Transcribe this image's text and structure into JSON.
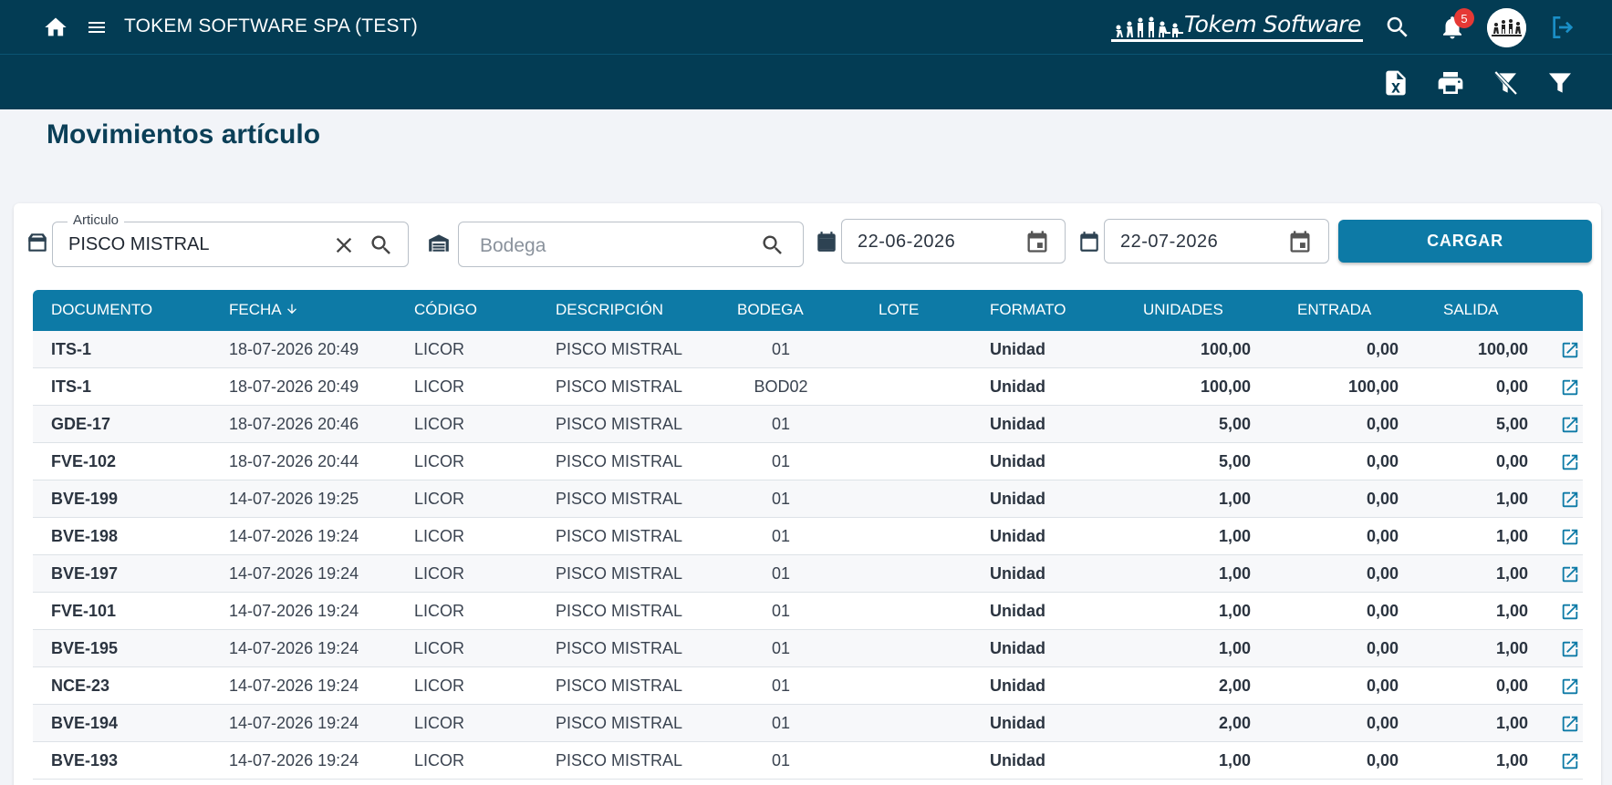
{
  "header": {
    "company": "TOKEM SOFTWARE SPA (TEST)",
    "brand": "Tokem Software",
    "notifications_count": "5",
    "icons": [
      "home-icon",
      "menu-icon",
      "search-icon",
      "bell-icon",
      "avatar",
      "logout-icon"
    ]
  },
  "toolbar": {
    "icons": [
      "excel-export-icon",
      "print-icon",
      "clear-filter-icon",
      "filter-icon"
    ]
  },
  "page": {
    "title": "Movimientos artículo"
  },
  "filters": {
    "articulo": {
      "label": "Articulo",
      "value": "PISCO MISTRAL"
    },
    "bodega": {
      "placeholder": "Bodega"
    },
    "fecha_desde": "22-06-2026",
    "fecha_hasta": "22-07-2026",
    "cargar_label": "CARGAR"
  },
  "table": {
    "columns": {
      "documento": "DOCUMENTO",
      "fecha": "FECHA",
      "codigo": "CÓDIGO",
      "descripcion": "DESCRIPCIÓN",
      "bodega": "BODEGA",
      "lote": "LOTE",
      "formato": "FORMATO",
      "unidades": "UNIDADES",
      "entrada": "ENTRADA",
      "salida": "SALIDA"
    },
    "sort": {
      "column": "fecha",
      "direction": "desc"
    },
    "rows": [
      {
        "documento": "ITS-1",
        "fecha": "18-07-2026 20:49",
        "codigo": "LICOR",
        "descripcion": "PISCO MISTRAL",
        "bodega": "01",
        "lote": "",
        "formato": "Unidad",
        "unidades": "100,00",
        "entrada": "0,00",
        "salida": "100,00"
      },
      {
        "documento": "ITS-1",
        "fecha": "18-07-2026 20:49",
        "codigo": "LICOR",
        "descripcion": "PISCO MISTRAL",
        "bodega": "BOD02",
        "lote": "",
        "formato": "Unidad",
        "unidades": "100,00",
        "entrada": "100,00",
        "salida": "0,00"
      },
      {
        "documento": "GDE-17",
        "fecha": "18-07-2026 20:46",
        "codigo": "LICOR",
        "descripcion": "PISCO MISTRAL",
        "bodega": "01",
        "lote": "",
        "formato": "Unidad",
        "unidades": "5,00",
        "entrada": "0,00",
        "salida": "5,00"
      },
      {
        "documento": "FVE-102",
        "fecha": "18-07-2026 20:44",
        "codigo": "LICOR",
        "descripcion": "PISCO MISTRAL",
        "bodega": "01",
        "lote": "",
        "formato": "Unidad",
        "unidades": "5,00",
        "entrada": "0,00",
        "salida": "0,00"
      },
      {
        "documento": "BVE-199",
        "fecha": "14-07-2026 19:25",
        "codigo": "LICOR",
        "descripcion": "PISCO MISTRAL",
        "bodega": "01",
        "lote": "",
        "formato": "Unidad",
        "unidades": "1,00",
        "entrada": "0,00",
        "salida": "1,00"
      },
      {
        "documento": "BVE-198",
        "fecha": "14-07-2026 19:24",
        "codigo": "LICOR",
        "descripcion": "PISCO MISTRAL",
        "bodega": "01",
        "lote": "",
        "formato": "Unidad",
        "unidades": "1,00",
        "entrada": "0,00",
        "salida": "1,00"
      },
      {
        "documento": "BVE-197",
        "fecha": "14-07-2026 19:24",
        "codigo": "LICOR",
        "descripcion": "PISCO MISTRAL",
        "bodega": "01",
        "lote": "",
        "formato": "Unidad",
        "unidades": "1,00",
        "entrada": "0,00",
        "salida": "1,00"
      },
      {
        "documento": "FVE-101",
        "fecha": "14-07-2026 19:24",
        "codigo": "LICOR",
        "descripcion": "PISCO MISTRAL",
        "bodega": "01",
        "lote": "",
        "formato": "Unidad",
        "unidades": "1,00",
        "entrada": "0,00",
        "salida": "1,00"
      },
      {
        "documento": "BVE-195",
        "fecha": "14-07-2026 19:24",
        "codigo": "LICOR",
        "descripcion": "PISCO MISTRAL",
        "bodega": "01",
        "lote": "",
        "formato": "Unidad",
        "unidades": "1,00",
        "entrada": "0,00",
        "salida": "1,00"
      },
      {
        "documento": "NCE-23",
        "fecha": "14-07-2026 19:24",
        "codigo": "LICOR",
        "descripcion": "PISCO MISTRAL",
        "bodega": "01",
        "lote": "",
        "formato": "Unidad",
        "unidades": "2,00",
        "entrada": "0,00",
        "salida": "0,00"
      },
      {
        "documento": "BVE-194",
        "fecha": "14-07-2026 19:24",
        "codigo": "LICOR",
        "descripcion": "PISCO MISTRAL",
        "bodega": "01",
        "lote": "",
        "formato": "Unidad",
        "unidades": "2,00",
        "entrada": "0,00",
        "salida": "1,00"
      },
      {
        "documento": "BVE-193",
        "fecha": "14-07-2026 19:24",
        "codigo": "LICOR",
        "descripcion": "PISCO MISTRAL",
        "bodega": "01",
        "lote": "",
        "formato": "Unidad",
        "unidades": "1,00",
        "entrada": "0,00",
        "salida": "1,00"
      }
    ]
  },
  "colors": {
    "header_bg": "#033c54",
    "accent": "#0d7aa6",
    "title": "#0b3f57",
    "badge": "#e53935"
  }
}
